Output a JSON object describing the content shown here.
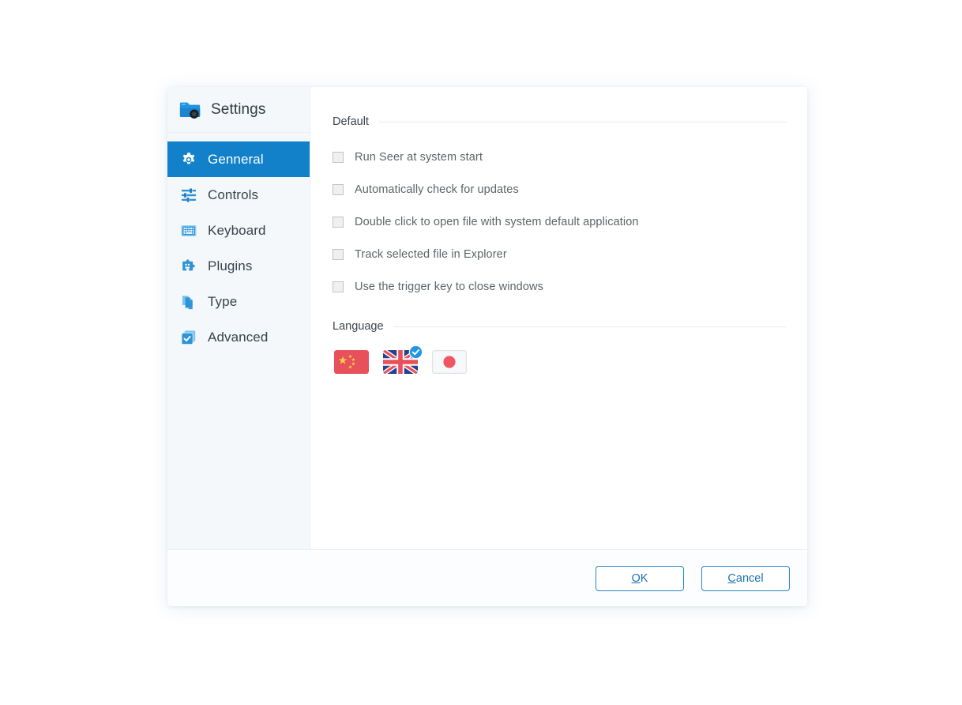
{
  "app": {
    "brand_label": "Settings",
    "brand_icon": "seer-folder-icon"
  },
  "sidebar": {
    "items": [
      {
        "label": "Genneral",
        "icon": "gear-icon",
        "active": true
      },
      {
        "label": "Controls",
        "icon": "sliders-icon",
        "active": false
      },
      {
        "label": "Keyboard",
        "icon": "keyboard-icon",
        "active": false
      },
      {
        "label": "Plugins",
        "icon": "puzzle-icon",
        "active": false
      },
      {
        "label": "Type",
        "icon": "document-text-cursor-icon",
        "active": false
      },
      {
        "label": "Advanced",
        "icon": "stacked-checkbox-icon",
        "active": false
      }
    ]
  },
  "main": {
    "default_section": {
      "title": "Default",
      "options": [
        {
          "label": "Run Seer at system start",
          "checked": false
        },
        {
          "label": "Automatically check for updates",
          "checked": false
        },
        {
          "label": "Double click to open file with system default application",
          "checked": false
        },
        {
          "label": "Track selected file in Explorer",
          "checked": false
        },
        {
          "label": "Use the trigger key to close windows",
          "checked": false
        }
      ]
    },
    "language_section": {
      "title": "Language",
      "flags": [
        {
          "name": "china-flag",
          "label": "Chinese",
          "selected": false
        },
        {
          "name": "uk-flag",
          "label": "English",
          "selected": true
        },
        {
          "name": "japan-flag",
          "label": "Japanese",
          "selected": false
        }
      ]
    }
  },
  "footer": {
    "ok_accel": "O",
    "ok_rest": "K",
    "cancel_accel": "C",
    "cancel_rest": "ancel"
  },
  "colors": {
    "accent": "#1281ca",
    "button_border": "#2a86c8",
    "button_text": "#1a70b4",
    "sidebar_bg": "#f4f8fb",
    "label_text": "#5d6469"
  }
}
